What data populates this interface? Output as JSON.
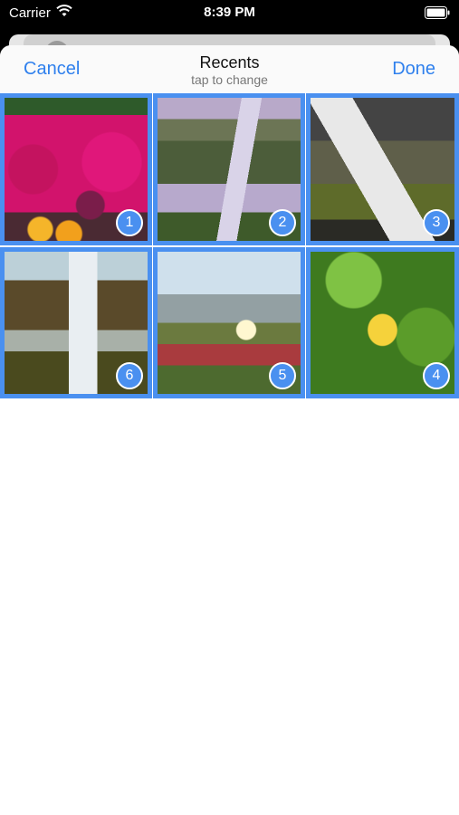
{
  "status_bar": {
    "carrier": "Carrier",
    "time": "8:39 PM",
    "wifi_icon": "wifi-icon",
    "battery_icon": "battery-icon"
  },
  "nav": {
    "cancel_label": "Cancel",
    "title": "Recents",
    "subtitle": "tap to change",
    "done_label": "Done"
  },
  "photos": [
    {
      "name": "photo-flowers",
      "selection": "1"
    },
    {
      "name": "photo-waterfall-cliff",
      "selection": "2"
    },
    {
      "name": "photo-waterfall-rocks",
      "selection": "3"
    },
    {
      "name": "photo-waterfall-shore",
      "selection": "6"
    },
    {
      "name": "photo-iceplant-flower",
      "selection": "5"
    },
    {
      "name": "photo-leaves",
      "selection": "4"
    }
  ],
  "colors": {
    "accent": "#2f80ed",
    "selection": "#4a90f0"
  }
}
